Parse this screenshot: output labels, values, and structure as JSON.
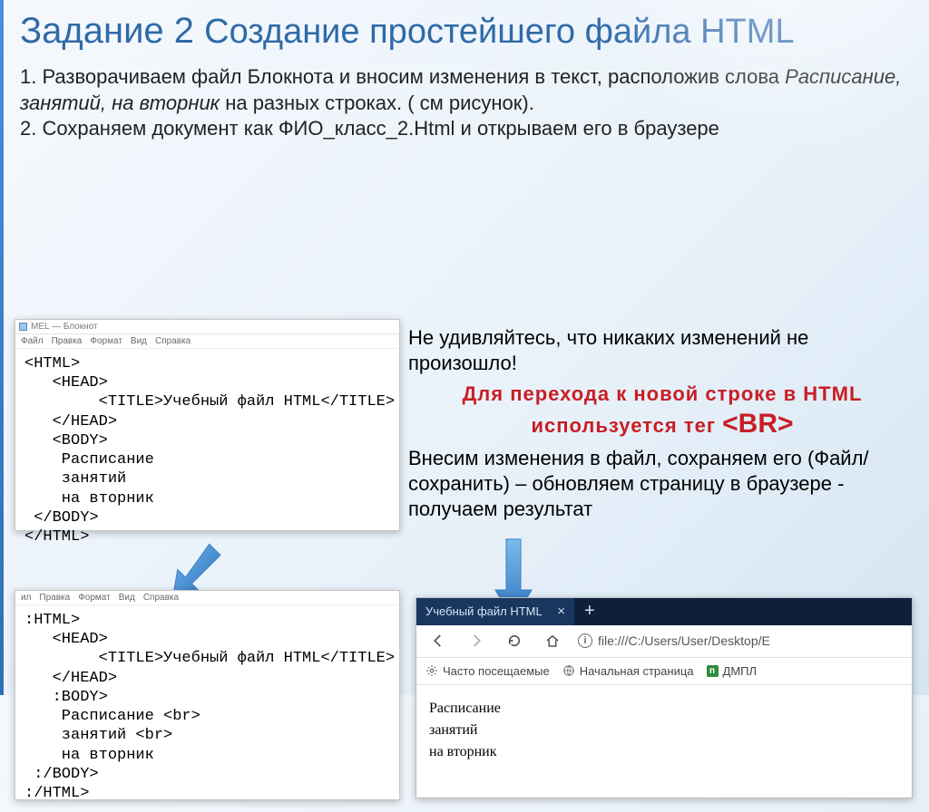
{
  "title_main": "Задание 2 ",
  "title_sub": "Создание простейшего файла HTML",
  "instr_line1a": "1. Разворачиваем файл Блокнота и вносим изменения в текст, расположив слова ",
  "instr_line1_em": "Расписание, занятий, на вторник",
  "instr_line1b": " на разных строках. ( см рисунок).",
  "instr_line2": "2. Сохраняем документ как ФИО_класс_2.Html и открываем его в браузере",
  "right": {
    "p1": "Не удивляйтесь, что никаких изменений не произошло!",
    "red_a": "Для перехода к новой строке в HTML используется тег ",
    "red_tag": "<BR>",
    "p2": "Внесим изменения в файл, сохраняем его (Файл/сохранить) – обновляем страницу в браузере - получаем результат"
  },
  "notepad": {
    "title": "MEL — Блокнот",
    "menu": [
      "Файл",
      "Правка",
      "Формат",
      "Вид",
      "Справка"
    ],
    "code1": "<HTML>\n   <HEAD>\n        <TITLE>Учебный файл HTML</TITLE>\n   </HEAD>\n   <BODY>\n    Расписание\n    занятий\n    на вторник\n </BODY>\n</HTML>",
    "menu2": [
      "ил",
      "Правка",
      "Формат",
      "Вид",
      "Справка"
    ],
    "code2": ":HTML>\n   <HEAD>\n        <TITLE>Учебный файл HTML</TITLE>\n   </HEAD>\n   :BODY>\n    Расписание <br>\n    занятий <br>\n    на вторник\n :/BODY>\n:/HTML>"
  },
  "browser": {
    "tab_title": "Учебный файл HTML",
    "tab_close": "×",
    "tab_new": "+",
    "url": "file:///C:/Users/User/Desktop/Е",
    "bm1": "Часто посещаемые",
    "bm2": "Начальная страница",
    "bm3": "ДМПЛ",
    "pg1": "Расписание",
    "pg2": "занятий",
    "pg3": "на вторник"
  }
}
